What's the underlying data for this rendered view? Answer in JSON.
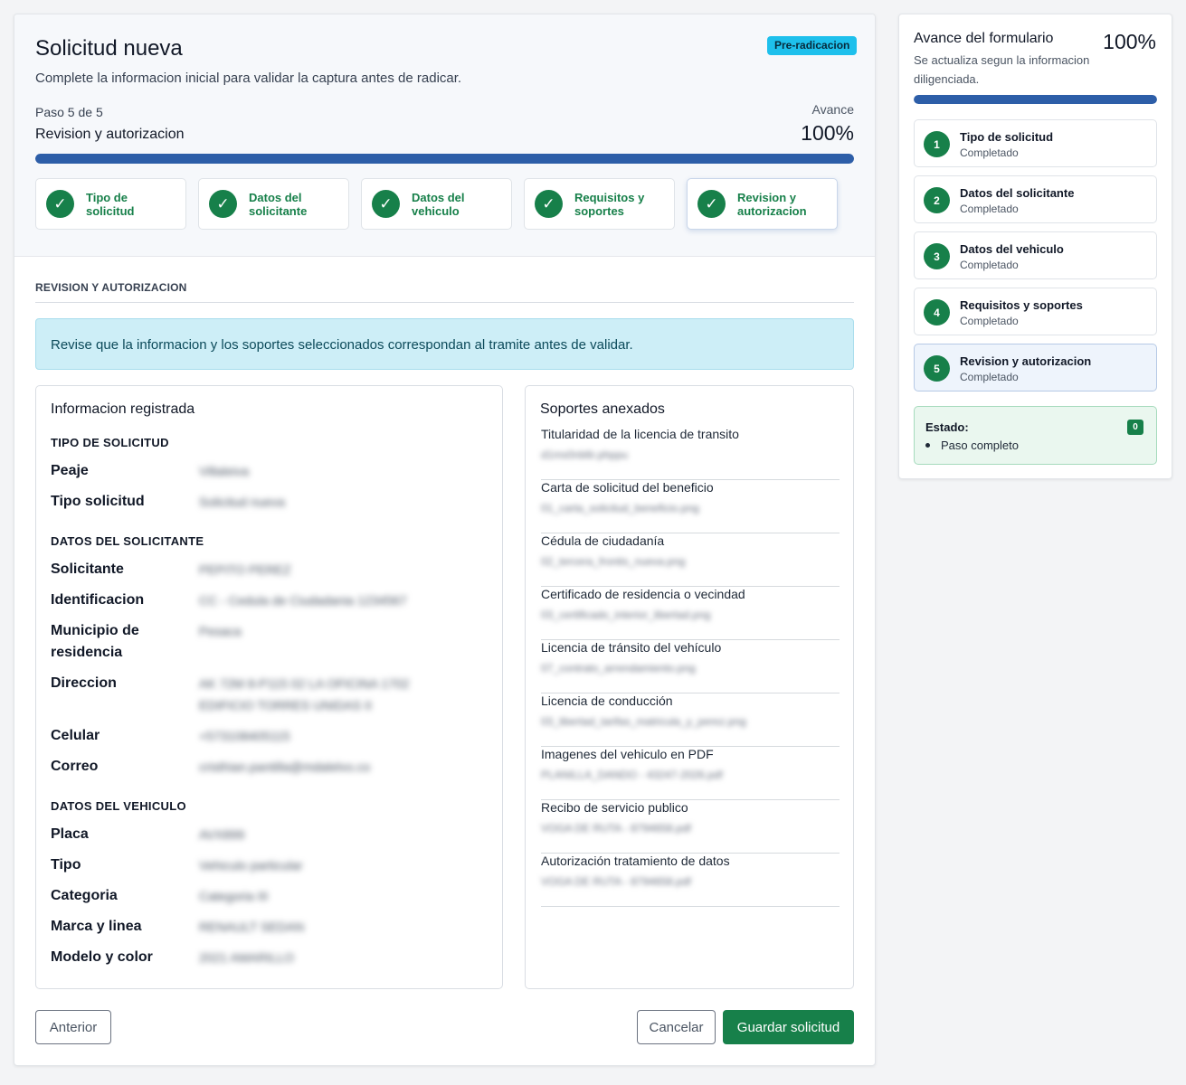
{
  "form": {
    "title": "Solicitud nueva",
    "subtitle": "Complete la informacion inicial para validar la captura antes de radicar.",
    "badge": "Pre-radicacion",
    "step_counter": "Paso 5 de 5",
    "step_name": "Revision y autorizacion",
    "avance_label": "Avance",
    "avance_value": "100%",
    "progress_fraction": 1.0,
    "accent_color": "#17804a",
    "progress_color": "#2d5ea8"
  },
  "stepper": [
    {
      "label": "Tipo de solicitud",
      "done": true
    },
    {
      "label": "Datos del solicitante",
      "done": true
    },
    {
      "label": "Datos del vehiculo",
      "done": true
    },
    {
      "label": "Requisitos y soportes",
      "done": true
    },
    {
      "label": "Revision y autorizacion",
      "done": true,
      "active": true
    }
  ],
  "review": {
    "section_title": "REVISION Y AUTORIZACION",
    "alert": "Revise que la informacion y los soportes seleccionados correspondan al tramite antes de validar."
  },
  "info": {
    "title": "Informacion registrada",
    "tipo": {
      "title": "TIPO DE SOLICITUD",
      "peaje": {
        "label": "Peaje",
        "value": "Villaleiva"
      },
      "tipo_solicitud": {
        "label": "Tipo solicitud",
        "value": "Solicitud nueva"
      }
    },
    "solicitante": {
      "title": "DATOS DEL SOLICITANTE",
      "solicitante": {
        "label": "Solicitante",
        "value": "PEPITO PEREZ"
      },
      "identificacion": {
        "label": "Identificacion",
        "value": "CC - Cedula de Ciudadania 1234567"
      },
      "municipio": {
        "label": "Municipio de residencia",
        "value": "Pesaca"
      },
      "direccion": {
        "label": "Direccion",
        "value_line1": "AK 72M 8-P115 02 LA OFICINA 1702",
        "value_line2": "EDIFICIO TORRES UNIDAS II"
      },
      "celular": {
        "label": "Celular",
        "value": "+573108405115"
      },
      "correo": {
        "label": "Correo",
        "value": "cristhian.pantilla@mdalelvo.co"
      }
    },
    "vehiculo": {
      "title": "DATOS DEL VEHICULO",
      "placa": {
        "label": "Placa",
        "value": "AVX899"
      },
      "tipo": {
        "label": "Tipo",
        "value": "Vehiculo particular"
      },
      "categoria": {
        "label": "Categoria",
        "value": "Categoria III"
      },
      "marca": {
        "label": "Marca y linea",
        "value": "RENAULT SEDAN"
      },
      "modelo": {
        "label": "Modelo y color",
        "value": "2021 AMARILLO"
      }
    }
  },
  "soportes": {
    "title": "Soportes anexados",
    "items": [
      {
        "name": "Titularidad de la licencia de transito",
        "file": "d1ms0nb6r.phppu"
      },
      {
        "name": "Carta de solicitud del beneficio",
        "file": "01_carta_solicitud_beneficio.png"
      },
      {
        "name": "Cédula de ciudadanía",
        "file": "02_tercera_frontis_nueva.png"
      },
      {
        "name": "Certificado de residencia o vecindad",
        "file": "03_certificado_interior_libertad.png"
      },
      {
        "name": "Licencia de tránsito del vehículo",
        "file": "07_contrato_arrendamiento.png"
      },
      {
        "name": "Licencia de conducción",
        "file": "03_libertad_tarifas_matricula_y_perez.png"
      },
      {
        "name": "Imagenes del vehiculo en PDF",
        "file": "PLANILLA_DANDO - 43247-2026.pdf"
      },
      {
        "name": "Recibo de servicio publico",
        "file": "VOGA DE RUTA - 8794658.pdf"
      },
      {
        "name": "Autorización tratamiento de datos",
        "file": "VOGA DE RUTA - 8794658.pdf"
      }
    ]
  },
  "actions": {
    "prev": "Anterior",
    "cancel": "Cancelar",
    "save": "Guardar solicitud"
  },
  "sidebar": {
    "title": "Avance del formulario",
    "pct": "100%",
    "desc": "Se actualiza segun la informacion diligenciada.",
    "progress_fraction": 1.0,
    "steps": [
      {
        "num": "1",
        "title": "Tipo de solicitud",
        "status": "Completado"
      },
      {
        "num": "2",
        "title": "Datos del solicitante",
        "status": "Completado"
      },
      {
        "num": "3",
        "title": "Datos del vehiculo",
        "status": "Completado"
      },
      {
        "num": "4",
        "title": "Requisitos y soportes",
        "status": "Completado"
      },
      {
        "num": "5",
        "title": "Revision y autorizacion",
        "status": "Completado"
      }
    ],
    "status": {
      "label": "Estado:",
      "count": "0",
      "item": "Paso completo"
    }
  }
}
